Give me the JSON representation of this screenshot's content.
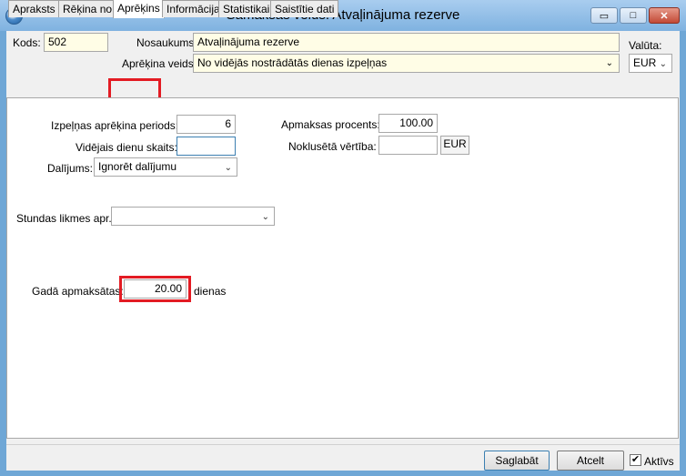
{
  "window": {
    "title": "Samaksas veids: Atvaļinājuma rezerve",
    "minimize_glyph": "▭",
    "maximize_glyph": "□",
    "close_glyph": "✕"
  },
  "header": {
    "kods_label": "Kods:",
    "kods_value": "502",
    "nosaukums_label": "Nosaukums:",
    "nosaukums_value": "Atvaļinājuma rezerve",
    "aprekina_veids_label": "Aprēķina veids:",
    "aprekina_veids_value": "No vidējās nostrādātās dienas izpeļņas",
    "valuta_label": "Valūta:",
    "valuta_value": "EUR"
  },
  "tabs": [
    {
      "label": "Apraksts"
    },
    {
      "label": "Rēķina no"
    },
    {
      "label": "Aprēķins"
    },
    {
      "label": "Informācija"
    },
    {
      "label": "Statistikai"
    },
    {
      "label": "Saistītie dati"
    }
  ],
  "aprekins": {
    "izpelnas_periods_label": "Izpeļņas aprēķina periods:",
    "izpelnas_periods_value": "6",
    "videjais_dienu_skaits_label": "Vidējais dienu skaits:",
    "videjais_dienu_skaits_value": "",
    "daljums_label": "Dalījums:",
    "daljums_value": "Ignorēt dalījumu",
    "apmaksas_procents_label": "Apmaksas procents:",
    "apmaksas_procents_value": "100.00",
    "nokluseta_vertiba_label": "Noklusētā vērtība:",
    "nokluseta_vertiba_value": "",
    "nokluseta_vertiba_currency": "EUR",
    "stundas_likmes_label": "Stundas likmes apr.:",
    "stundas_likmes_value": "",
    "gada_apmaksatas_label": "Gadā apmaksātas:",
    "gada_apmaksatas_value": "20.00",
    "gada_apmaksatas_unit": "dienas"
  },
  "footer": {
    "save_label": "Saglabāt",
    "cancel_label": "Atcelt",
    "active_label": "Aktīvs",
    "active_checked_glyph": "✔"
  },
  "colors": {
    "highlight": "#e31b23",
    "readonly_field": "#fffde6"
  }
}
